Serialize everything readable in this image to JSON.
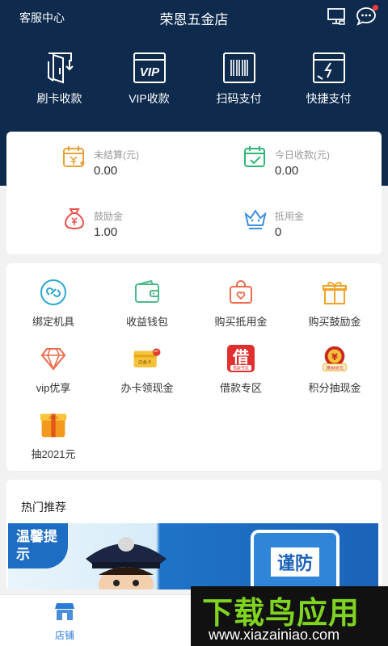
{
  "header": {
    "left_link": "客服中心",
    "title": "荣恩五金店",
    "icons": [
      "monitor-icon",
      "message-icon"
    ]
  },
  "quick_actions": [
    {
      "label": "刷卡收款",
      "icon": "card-swipe-icon"
    },
    {
      "label": "VIP收款",
      "icon": "vip-icon",
      "badge": "VIP"
    },
    {
      "label": "扫码支付",
      "icon": "barcode-scan-icon"
    },
    {
      "label": "快捷支付",
      "icon": "quick-pay-icon"
    }
  ],
  "stats": [
    {
      "label": "未结算(元)",
      "value": "0.00",
      "icon": "calendar-yen-icon",
      "color": "#e8a23a"
    },
    {
      "label": "今日收款(元)",
      "value": "0.00",
      "icon": "calendar-check-icon",
      "color": "#2eb872"
    },
    {
      "label": "鼓励金",
      "value": "1.00",
      "icon": "money-bag-icon",
      "color": "#e8504a"
    },
    {
      "label": "抵用金",
      "value": "0",
      "icon": "crown-icon",
      "color": "#3a8fe0"
    }
  ],
  "menu": [
    {
      "label": "绑定机具",
      "icon": "link-icon"
    },
    {
      "label": "收益钱包",
      "icon": "wallet-icon"
    },
    {
      "label": "购买抵用金",
      "icon": "shopping-bag-icon"
    },
    {
      "label": "购买鼓励金",
      "icon": "gift-icon"
    },
    {
      "label": "vip优享",
      "icon": "diamond-icon"
    },
    {
      "label": "办卡领现金",
      "icon": "credit-card-icon",
      "badge": "白金卡"
    },
    {
      "label": "借款专区",
      "icon": "loan-icon",
      "badge": "借",
      "sub": "借款专区"
    },
    {
      "label": "积分抽现金",
      "icon": "points-lottery-icon",
      "badge": "领888元"
    },
    {
      "label": "抽2021元",
      "icon": "lucky-box-icon"
    }
  ],
  "hot": {
    "title": "热门推荐",
    "banner_tag": "温馨提示",
    "banner_text": "谨防"
  },
  "tabbar": {
    "store_label": "店铺"
  },
  "watermark": {
    "brand": "下载鸟应用",
    "url": "www.xiazainiao.com"
  }
}
